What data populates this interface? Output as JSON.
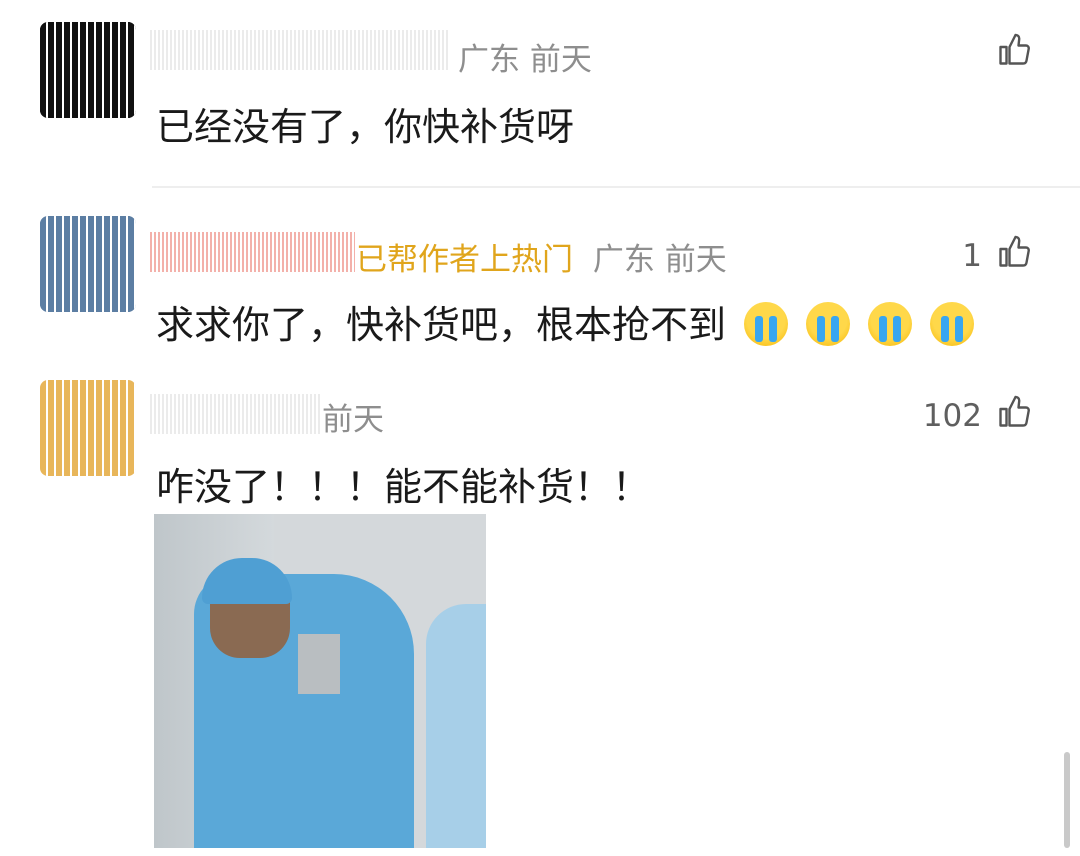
{
  "comments": [
    {
      "region": "广东",
      "time": "前天",
      "text": "已经没有了，你快补货呀",
      "likes": ""
    },
    {
      "badge": "已帮作者上热门",
      "region": "广东",
      "time": "前天",
      "text": "求求你了，快补货吧，根本抢不到",
      "likes": "1",
      "emoji": [
        "crying-emoji",
        "crying-emoji",
        "crying-emoji",
        "crying-emoji"
      ]
    },
    {
      "time": "前天",
      "text": "咋没了！！！能不能补货！！",
      "likes": "102"
    }
  ],
  "icons": {
    "like": "thumbs-up-icon"
  },
  "colors": {
    "badge": "#e0a51c",
    "meta": "#8e8e8e",
    "text": "#1a1a1a"
  }
}
